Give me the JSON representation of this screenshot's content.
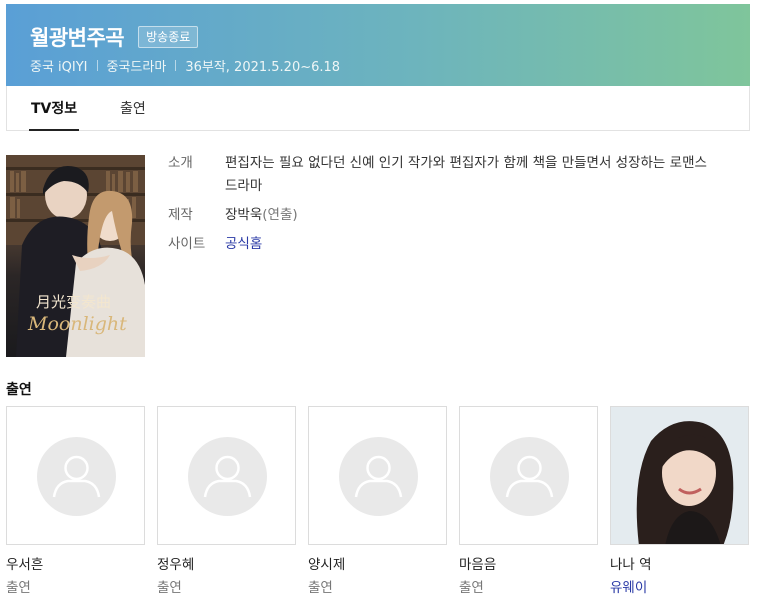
{
  "header": {
    "title": "월광변주곡",
    "status_badge": "방송종료",
    "meta": [
      "중국 iQIYI",
      "중국드라마",
      "36부작, 2021.5.20~6.18"
    ]
  },
  "tabs": [
    {
      "label": "TV정보",
      "active": true
    },
    {
      "label": "출연",
      "active": false
    }
  ],
  "poster": {
    "title_cn": "月光变奏曲",
    "title_en": "Moonlight"
  },
  "info": {
    "synopsis_label": "소개",
    "synopsis": "편집자는 필요 없다던 신예 인기 작가와 편집자가 함께 책을 만들면서 성장하는 로맨스 드라마",
    "production_label": "제작",
    "production_name": "장박욱",
    "production_role": "(연출)",
    "site_label": "사이트",
    "site_link": "공식홈"
  },
  "cast": {
    "heading": "출연",
    "members": [
      {
        "name": "우서흔",
        "role": "출연",
        "has_photo": false,
        "role_is_link": false
      },
      {
        "name": "정우혜",
        "role": "출연",
        "has_photo": false,
        "role_is_link": false
      },
      {
        "name": "양시제",
        "role": "출연",
        "has_photo": false,
        "role_is_link": false
      },
      {
        "name": "마음음",
        "role": "출연",
        "has_photo": false,
        "role_is_link": false
      },
      {
        "name": "나나 역",
        "role": "유웨이",
        "has_photo": true,
        "role_is_link": true
      }
    ]
  },
  "colors": {
    "header_gradient_start": "#5a9fd6",
    "header_gradient_end": "#7fc59b",
    "link": "#2a3aa6"
  }
}
